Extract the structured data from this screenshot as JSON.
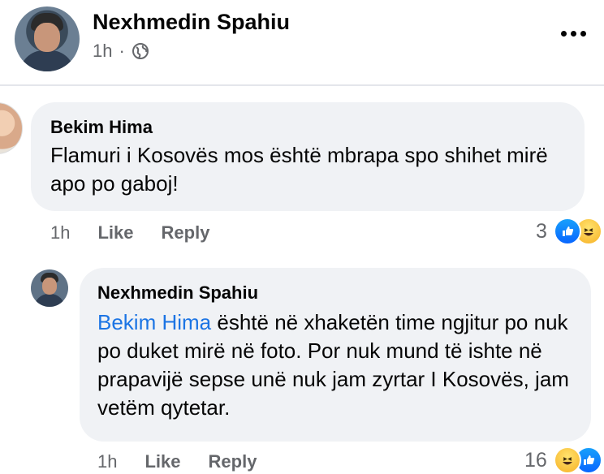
{
  "post": {
    "author": "Nexhmedin Spahiu",
    "time": "1h",
    "separator": "·",
    "privacy_icon": "globe-icon",
    "more_icon": "more-options-icon"
  },
  "comments": [
    {
      "author": "Bekim Hima",
      "text": "Flamuri i Kosovës mos është mbrapa spo shihet mirë apo po gaboj!",
      "time": "1h",
      "like_label": "Like",
      "reply_label": "Reply",
      "reaction_count": "3",
      "reactions": [
        "like-icon",
        "haha-icon"
      ]
    },
    {
      "author": "Nexhmedin Spahiu",
      "mention": "Bekim Hima",
      "text": "është në xhaketën time ngjitur po nuk po duket mirë në foto. Por nuk mund të ishte në prapavijë sepse unë  nuk jam zyrtar I Kosovës, jam vetëm qytetar.",
      "time": "1h",
      "like_label": "Like",
      "reply_label": "Reply",
      "reaction_count": "16",
      "reactions": [
        "haha-icon",
        "like-icon"
      ]
    }
  ],
  "colors": {
    "bubble": "#f0f2f5",
    "mention": "#1b74e4",
    "secondary_text": "#65676b",
    "like_blue": "#0866ff"
  }
}
